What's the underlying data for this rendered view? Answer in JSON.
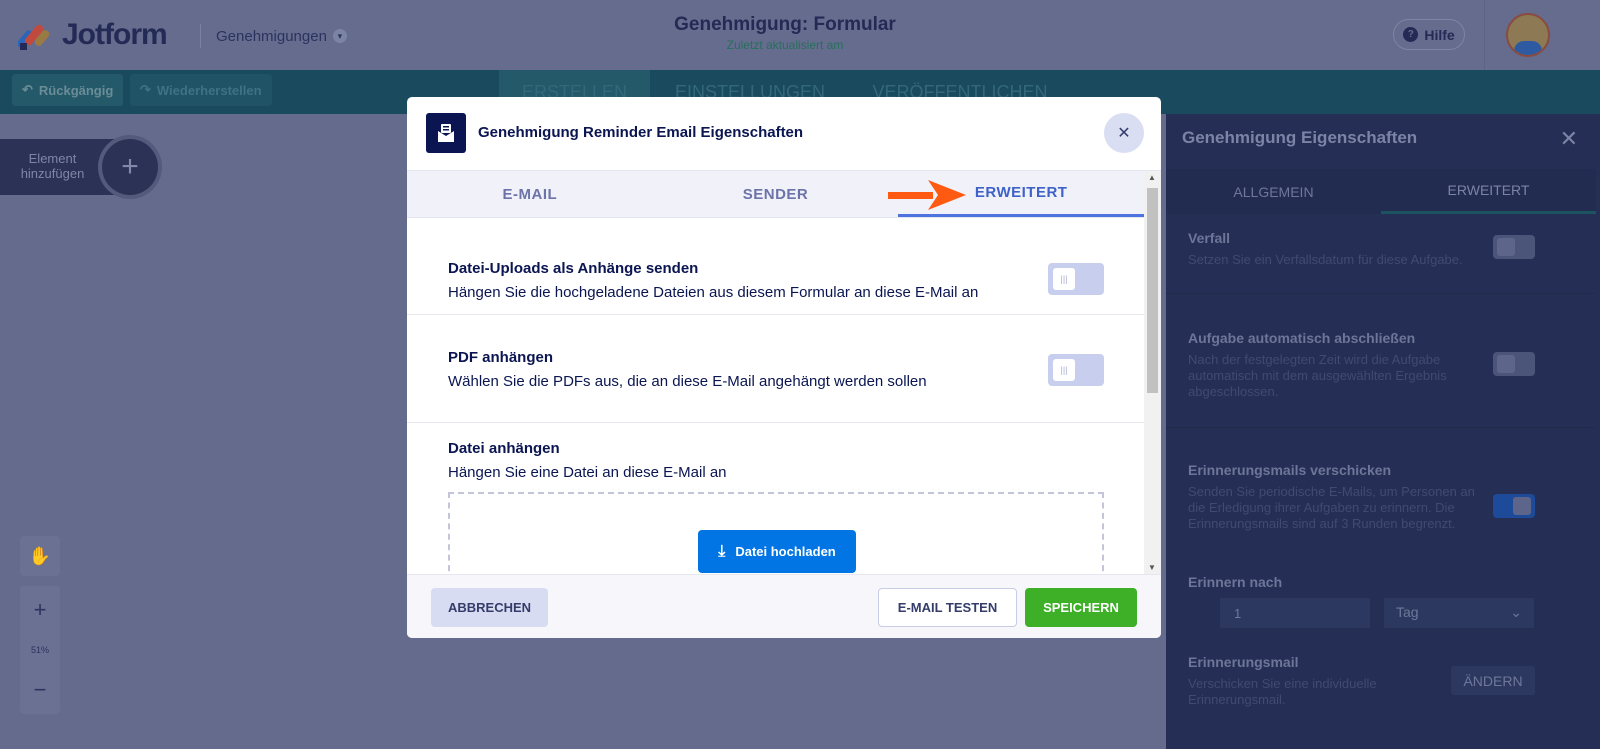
{
  "header": {
    "logo": "Jotform",
    "breadcrumb": "Genehmigungen",
    "title": "Genehmigung: Formular",
    "subtitle": "Zuletzt aktualisiert am",
    "help": "Hilfe"
  },
  "toolbar": {
    "undo": "Rückgängig",
    "redo": "Wiederherstellen",
    "tabs": [
      "ERSTELLEN",
      "EINSTELLUNGEN",
      "VERÖFFENTLICHEN"
    ]
  },
  "canvas": {
    "add_element": "Element hinzufügen",
    "zoom_level": "51%"
  },
  "right_panel": {
    "title": "Genehmigung Eigenschaften",
    "tabs": [
      "ALLGEMEIN",
      "ERWEITERT"
    ],
    "sections": [
      {
        "title": "Verfall",
        "desc": "Setzen Sie ein Verfallsdatum für diese Aufgabe.",
        "toggle": false
      },
      {
        "title": "Aufgabe automatisch abschließen",
        "desc": "Nach der festgelegten Zeit wird die Aufgabe automatisch mit dem ausgewählten Ergebnis abgeschlossen.",
        "toggle": false
      },
      {
        "title": "Erinnerungsmails verschicken",
        "desc": "Senden Sie periodische E-Mails, um Personen an die Erledigung ihrer Aufgaben zu erinnern. Die Erinnerungsmails sind auf 3 Runden begrenzt.",
        "toggle": true
      }
    ],
    "remind_after": {
      "label": "Erinnern nach",
      "value": "1",
      "unit": "Tag"
    },
    "reminder_mail": {
      "title": "Erinnerungsmail",
      "desc": "Verschicken Sie eine individuelle Erinnerungsmail.",
      "button": "ÄNDERN"
    }
  },
  "modal": {
    "title": "Genehmigung Reminder Email Eigenschaften",
    "tabs": [
      "E-MAIL",
      "SENDER",
      "ERWEITERT"
    ],
    "active_tab": "ERWEITERT",
    "sections": [
      {
        "title": "Datei-Uploads als Anhänge senden",
        "desc": "Hängen Sie die hochgeladene Dateien aus diesem Formular an diese E-Mail an",
        "toggle": false
      },
      {
        "title": "PDF anhängen",
        "desc": "Wählen Sie die PDFs aus, die an diese E-Mail angehängt werden sollen",
        "toggle": false
      },
      {
        "title": "Datei anhängen",
        "desc": "Hängen Sie eine Datei an diese E-Mail an"
      }
    ],
    "upload_button": "Datei hochladen",
    "cancel": "ABBRECHEN",
    "test": "E-MAIL TESTEN",
    "save": "SPEICHERN"
  },
  "colors": {
    "accent": "#4e73e0",
    "save": "#3db028",
    "upload": "#0075e3",
    "arrow": "#ff5a12"
  }
}
